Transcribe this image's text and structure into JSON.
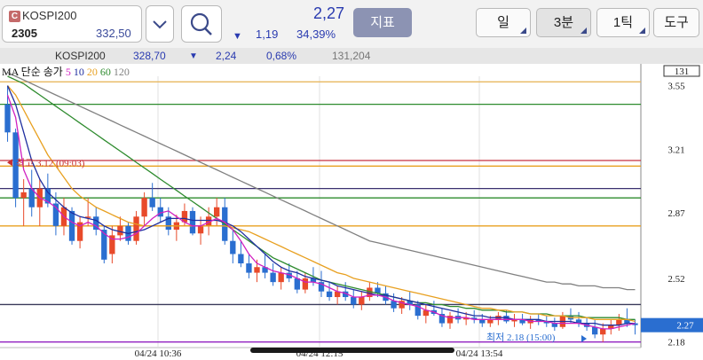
{
  "symbol": {
    "badge": "C",
    "name": "KOSPI200",
    "code": "2305",
    "index_value": "332,50"
  },
  "quote": {
    "price": "2,27",
    "arrow": "▼",
    "change": "1,19",
    "percent": "34,39%"
  },
  "toolbar": {
    "indicator_label": "지표",
    "day_label": "일",
    "period_label": "3분",
    "tick_label": "1틱",
    "tools_label": "도구"
  },
  "subbar": {
    "name": "KOSPI200",
    "value": "328,70",
    "arrow": "▼",
    "change": "2,24",
    "percent": "0,68%",
    "volume": "131,204"
  },
  "ma_legend": {
    "label": "MA 단순 송가",
    "p5": "5",
    "p10": "10",
    "p20": "20",
    "p60": "60",
    "p120": "120"
  },
  "colors": {
    "ma5": "#d020c0",
    "ma10": "#1f2fa0",
    "ma20": "#e8a020",
    "ma60": "#2e8b2e",
    "ma120": "#808080",
    "up": "#e84a2a",
    "down": "#2a6ed0"
  },
  "chart_data": {
    "type": "candlestick",
    "ylim": [
      2.15,
      3.6
    ],
    "y_ticks": [
      "3.55",
      "3.21",
      "2.87",
      "2.52",
      "2.18"
    ],
    "volume_tag": "131",
    "current_tag": "2.27",
    "x_ticks": [
      "04/24 10:36",
      "04/24 12:15",
      "04/24 13:54"
    ],
    "annotations": {
      "high": "최고 3.12 (09:03)",
      "low": "최저 2.18 (15:00)"
    },
    "candles": [
      [
        3.45,
        3.55,
        3.25,
        3.3
      ],
      [
        3.3,
        3.32,
        2.9,
        2.95
      ],
      [
        2.95,
        3.05,
        2.8,
        2.98
      ],
      [
        3.0,
        3.1,
        2.85,
        2.9
      ],
      [
        2.9,
        3.05,
        2.8,
        3.0
      ],
      [
        3.0,
        3.08,
        2.9,
        2.92
      ],
      [
        2.92,
        2.98,
        2.75,
        2.8
      ],
      [
        2.8,
        2.95,
        2.75,
        2.9
      ],
      [
        2.88,
        2.9,
        2.7,
        2.72
      ],
      [
        2.72,
        2.85,
        2.68,
        2.82
      ],
      [
        2.85,
        2.95,
        2.8,
        2.85
      ],
      [
        2.85,
        2.9,
        2.75,
        2.78
      ],
      [
        2.78,
        2.8,
        2.6,
        2.62
      ],
      [
        2.65,
        2.8,
        2.6,
        2.75
      ],
      [
        2.75,
        2.85,
        2.72,
        2.8
      ],
      [
        2.8,
        2.82,
        2.7,
        2.72
      ],
      [
        2.72,
        2.88,
        2.7,
        2.85
      ],
      [
        2.85,
        2.98,
        2.8,
        2.95
      ],
      [
        2.95,
        3.03,
        2.88,
        2.9
      ],
      [
        2.9,
        2.95,
        2.82,
        2.85
      ],
      [
        2.85,
        2.9,
        2.75,
        2.78
      ],
      [
        2.78,
        2.86,
        2.72,
        2.82
      ],
      [
        2.82,
        2.92,
        2.8,
        2.88
      ],
      [
        2.88,
        2.9,
        2.75,
        2.76
      ],
      [
        2.76,
        2.85,
        2.7,
        2.8
      ],
      [
        2.8,
        2.9,
        2.75,
        2.85
      ],
      [
        2.85,
        2.95,
        2.8,
        2.9
      ],
      [
        2.9,
        2.95,
        2.7,
        2.72
      ],
      [
        2.72,
        2.78,
        2.6,
        2.65
      ],
      [
        2.65,
        2.72,
        2.58,
        2.6
      ],
      [
        2.6,
        2.65,
        2.52,
        2.55
      ],
      [
        2.55,
        2.62,
        2.5,
        2.58
      ],
      [
        2.58,
        2.65,
        2.52,
        2.55
      ],
      [
        2.55,
        2.6,
        2.48,
        2.5
      ],
      [
        2.5,
        2.58,
        2.46,
        2.55
      ],
      [
        2.55,
        2.6,
        2.5,
        2.52
      ],
      [
        2.52,
        2.56,
        2.44,
        2.46
      ],
      [
        2.46,
        2.55,
        2.44,
        2.52
      ],
      [
        2.52,
        2.58,
        2.48,
        2.5
      ],
      [
        2.5,
        2.56,
        2.42,
        2.45
      ],
      [
        2.45,
        2.5,
        2.4,
        2.42
      ],
      [
        2.42,
        2.48,
        2.38,
        2.45
      ],
      [
        2.45,
        2.5,
        2.4,
        2.42
      ],
      [
        2.42,
        2.46,
        2.36,
        2.38
      ],
      [
        2.38,
        2.45,
        2.35,
        2.42
      ],
      [
        2.42,
        2.5,
        2.4,
        2.47
      ],
      [
        2.47,
        2.5,
        2.42,
        2.44
      ],
      [
        2.44,
        2.48,
        2.38,
        2.4
      ],
      [
        2.4,
        2.44,
        2.34,
        2.36
      ],
      [
        2.36,
        2.42,
        2.33,
        2.4
      ],
      [
        2.4,
        2.45,
        2.35,
        2.38
      ],
      [
        2.38,
        2.4,
        2.3,
        2.32
      ],
      [
        2.32,
        2.38,
        2.28,
        2.35
      ],
      [
        2.35,
        2.4,
        2.32,
        2.33
      ],
      [
        2.33,
        2.36,
        2.26,
        2.28
      ],
      [
        2.28,
        2.34,
        2.25,
        2.32
      ],
      [
        2.32,
        2.36,
        2.28,
        2.3
      ],
      [
        2.3,
        2.34,
        2.27,
        2.31
      ],
      [
        2.31,
        2.35,
        2.28,
        2.3
      ],
      [
        2.3,
        2.33,
        2.26,
        2.28
      ],
      [
        2.28,
        2.32,
        2.26,
        2.3
      ],
      [
        2.3,
        2.34,
        2.27,
        2.32
      ],
      [
        2.32,
        2.35,
        2.28,
        2.29
      ],
      [
        2.29,
        2.33,
        2.26,
        2.3
      ],
      [
        2.3,
        2.33,
        2.27,
        2.28
      ],
      [
        2.28,
        2.32,
        2.25,
        2.3
      ],
      [
        2.3,
        2.33,
        2.27,
        2.29
      ],
      [
        2.29,
        2.32,
        2.26,
        2.28
      ],
      [
        2.28,
        2.31,
        2.24,
        2.26
      ],
      [
        2.26,
        2.34,
        2.25,
        2.32
      ],
      [
        2.32,
        2.36,
        2.28,
        2.3
      ],
      [
        2.3,
        2.34,
        2.26,
        2.28
      ],
      [
        2.28,
        2.31,
        2.24,
        2.26
      ],
      [
        2.26,
        2.3,
        2.2,
        2.22
      ],
      [
        2.22,
        2.28,
        2.18,
        2.25
      ],
      [
        2.25,
        2.3,
        2.22,
        2.27
      ],
      [
        2.27,
        2.33,
        2.24,
        2.3
      ],
      [
        2.3,
        2.36,
        2.26,
        2.28
      ],
      [
        2.28,
        2.3,
        2.22,
        2.27
      ]
    ],
    "ma5": [
      3.5,
      3.38,
      3.1,
      3.0,
      2.95,
      2.93,
      2.9,
      2.85,
      2.82,
      2.8,
      2.82,
      2.8,
      2.76,
      2.73,
      2.73,
      2.74,
      2.76,
      2.8,
      2.84,
      2.87,
      2.88,
      2.85,
      2.82,
      2.8,
      2.8,
      2.82,
      2.84,
      2.82,
      2.78,
      2.72,
      2.65,
      2.6,
      2.58,
      2.56,
      2.55,
      2.54,
      2.52,
      2.5,
      2.5,
      2.49,
      2.47,
      2.45,
      2.44,
      2.42,
      2.42,
      2.43,
      2.43,
      2.42,
      2.4,
      2.39,
      2.38,
      2.37,
      2.35,
      2.34,
      2.32,
      2.31,
      2.31,
      2.31,
      2.3,
      2.3,
      2.3,
      2.3,
      2.3,
      2.3,
      2.3,
      2.29,
      2.29,
      2.29,
      2.28,
      2.28,
      2.28,
      2.28,
      2.27,
      2.26,
      2.25,
      2.25,
      2.26,
      2.27,
      2.28
    ],
    "ma10": [
      3.55,
      3.45,
      3.3,
      3.15,
      3.05,
      2.98,
      2.94,
      2.9,
      2.87,
      2.85,
      2.84,
      2.83,
      2.8,
      2.78,
      2.77,
      2.76,
      2.77,
      2.78,
      2.8,
      2.82,
      2.84,
      2.84,
      2.84,
      2.83,
      2.83,
      2.83,
      2.83,
      2.82,
      2.8,
      2.77,
      2.73,
      2.69,
      2.65,
      2.61,
      2.58,
      2.56,
      2.55,
      2.53,
      2.52,
      2.51,
      2.5,
      2.48,
      2.47,
      2.46,
      2.45,
      2.44,
      2.43,
      2.43,
      2.42,
      2.41,
      2.4,
      2.39,
      2.38,
      2.37,
      2.36,
      2.35,
      2.34,
      2.33,
      2.32,
      2.32,
      2.31,
      2.31,
      2.31,
      2.3,
      2.3,
      2.3,
      2.3,
      2.29,
      2.29,
      2.29,
      2.29,
      2.28,
      2.28,
      2.28,
      2.27,
      2.27,
      2.27,
      2.28,
      2.28
    ],
    "ma20": [
      3.55,
      3.5,
      3.42,
      3.34,
      3.26,
      3.18,
      3.12,
      3.06,
      3.0,
      2.96,
      2.93,
      2.9,
      2.88,
      2.86,
      2.84,
      2.82,
      2.81,
      2.8,
      2.8,
      2.8,
      2.8,
      2.8,
      2.8,
      2.8,
      2.8,
      2.8,
      2.8,
      2.8,
      2.79,
      2.78,
      2.77,
      2.75,
      2.73,
      2.71,
      2.69,
      2.67,
      2.65,
      2.63,
      2.61,
      2.59,
      2.57,
      2.55,
      2.54,
      2.52,
      2.51,
      2.5,
      2.49,
      2.48,
      2.47,
      2.46,
      2.45,
      2.44,
      2.43,
      2.42,
      2.41,
      2.4,
      2.39,
      2.38,
      2.37,
      2.36,
      2.36,
      2.35,
      2.35,
      2.34,
      2.34,
      2.33,
      2.33,
      2.32,
      2.32,
      2.32,
      2.31,
      2.31,
      2.31,
      2.3,
      2.3,
      2.3,
      2.3,
      2.3,
      2.29
    ],
    "ma60": [
      3.6,
      3.58,
      3.56,
      3.53,
      3.5,
      3.47,
      3.44,
      3.41,
      3.38,
      3.35,
      3.32,
      3.29,
      3.26,
      3.23,
      3.2,
      3.17,
      3.14,
      3.11,
      3.08,
      3.05,
      3.02,
      2.99,
      2.96,
      2.93,
      2.9,
      2.87,
      2.84,
      2.81,
      2.78,
      2.75,
      2.72,
      2.69,
      2.66,
      2.63,
      2.61,
      2.59,
      2.57,
      2.55,
      2.53,
      2.51,
      2.5,
      2.49,
      2.48,
      2.47,
      2.46,
      2.45,
      2.44,
      2.43,
      2.42,
      2.41,
      2.4,
      2.39,
      2.39,
      2.38,
      2.38,
      2.37,
      2.37,
      2.36,
      2.36,
      2.35,
      2.35,
      2.35,
      2.34,
      2.34,
      2.34,
      2.33,
      2.33,
      2.33,
      2.32,
      2.32,
      2.32,
      2.32,
      2.31,
      2.31,
      2.31,
      2.31,
      2.31,
      2.3,
      2.3
    ],
    "ma120": [
      3.62,
      3.6,
      3.58,
      3.56,
      3.54,
      3.52,
      3.5,
      3.48,
      3.46,
      3.44,
      3.42,
      3.4,
      3.38,
      3.36,
      3.34,
      3.32,
      3.3,
      3.28,
      3.26,
      3.24,
      3.22,
      3.2,
      3.18,
      3.16,
      3.14,
      3.12,
      3.1,
      3.08,
      3.06,
      3.04,
      3.02,
      3.0,
      2.98,
      2.96,
      2.94,
      2.92,
      2.9,
      2.88,
      2.86,
      2.84,
      2.82,
      2.8,
      2.78,
      2.76,
      2.74,
      2.72,
      2.71,
      2.7,
      2.69,
      2.68,
      2.67,
      2.66,
      2.65,
      2.64,
      2.63,
      2.62,
      2.61,
      2.6,
      2.59,
      2.58,
      2.57,
      2.56,
      2.55,
      2.54,
      2.53,
      2.52,
      2.51,
      2.5,
      2.5,
      2.49,
      2.49,
      2.48,
      2.48,
      2.48,
      2.47,
      2.47,
      2.47,
      2.46,
      2.46
    ],
    "h_lines": [
      {
        "y": 3.57,
        "color": "#e8b860"
      },
      {
        "y": 3.45,
        "color": "#2e8b2e"
      },
      {
        "y": 3.15,
        "color": "#c83040"
      },
      {
        "y": 3.12,
        "color": "#e8a020"
      },
      {
        "y": 3.0,
        "color": "#3a3070"
      },
      {
        "y": 2.95,
        "color": "#2e8b2e"
      },
      {
        "y": 2.8,
        "color": "#e8a020"
      },
      {
        "y": 2.38,
        "color": "#3a3a5a"
      },
      {
        "y": 2.18,
        "color": "#9020c0"
      }
    ]
  }
}
